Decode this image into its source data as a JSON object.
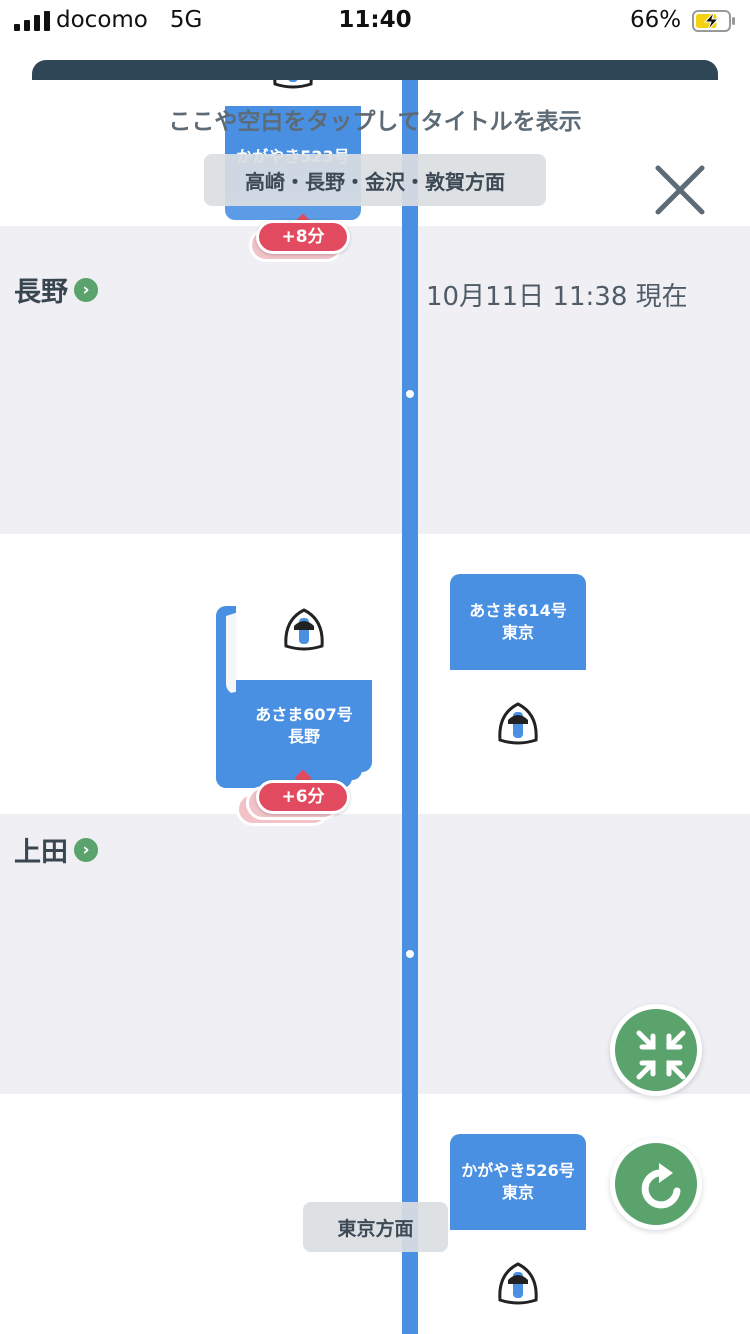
{
  "status_bar": {
    "carrier": "docomo",
    "network": "5G",
    "time": "11:40",
    "battery_percent": "66%",
    "battery_level": 0.66,
    "battery_charging": true
  },
  "header": {
    "hint": "ここや空白をタップしてタイトルを表示",
    "direction_up": "高崎・長野・金沢・敦賀方面",
    "timestamp": "10月11日 11:38 現在"
  },
  "stations": [
    {
      "name": "長野",
      "chevron": "›"
    },
    {
      "name": "上田",
      "chevron": "›"
    }
  ],
  "trains": {
    "kagayaki_523": {
      "name": "かがやき523号",
      "delay": "+8分"
    },
    "asama_607": {
      "name": "あさま607号",
      "dest": "長野",
      "delay": "+6分"
    },
    "asama_614": {
      "name": "あさま614号",
      "dest": "東京"
    },
    "kagayaki_526": {
      "name": "かがやき526号",
      "dest": "東京"
    }
  },
  "footer": {
    "direction_down": "東京方面"
  },
  "icons": {
    "close": "close-icon",
    "collapse": "collapse-arrows-icon",
    "refresh": "refresh-icon",
    "train": "shinkansen-train-icon"
  },
  "colors": {
    "track": "#4a90e2",
    "card_blue": "#4a90e2",
    "delay_red": "#e24b5f",
    "fab_green": "#5aa36d",
    "band_gray": "#efeff4"
  }
}
